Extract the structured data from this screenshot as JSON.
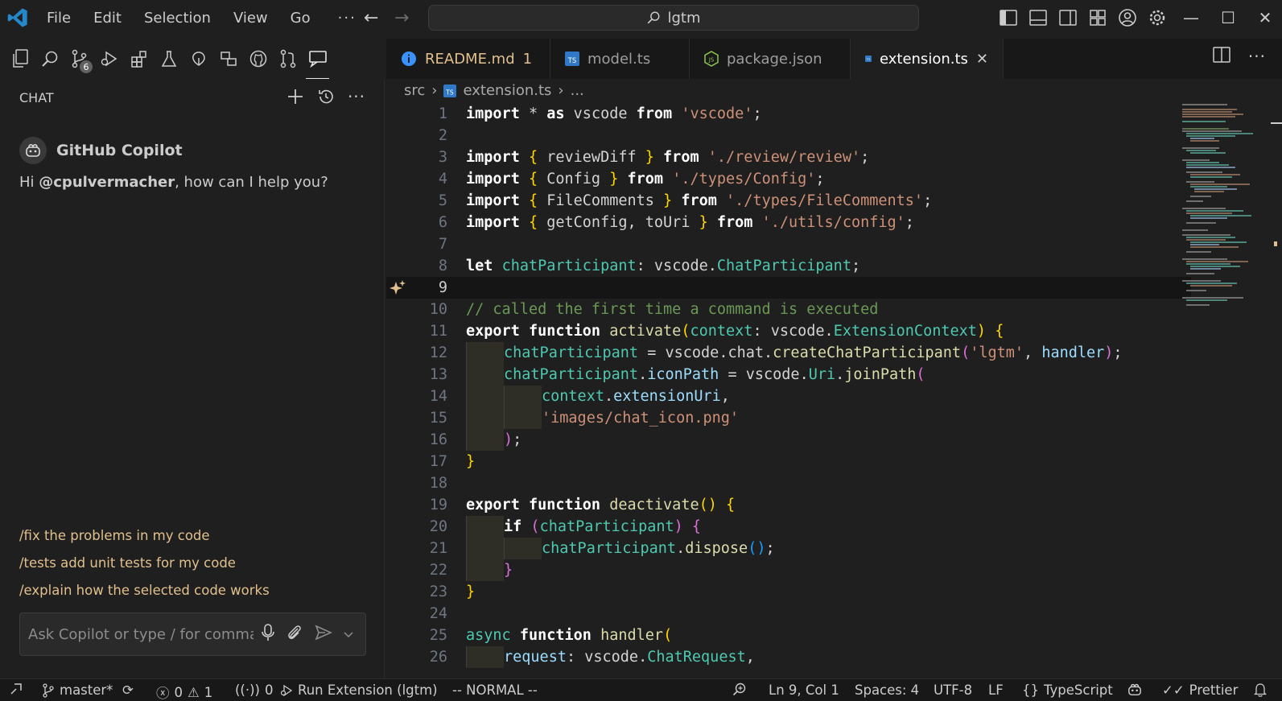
{
  "titlebar": {
    "menu": [
      "File",
      "Edit",
      "Selection",
      "View",
      "Go"
    ],
    "more": "···",
    "search_text": "lgtm"
  },
  "activity": {
    "items": [
      "explorer-icon",
      "search-icon",
      "source-control-icon",
      "run-debug-icon",
      "extensions-icon",
      "testing-icon",
      "live-share-icon",
      "remote-explorer-icon",
      "github-icon",
      "pull-requests-icon",
      "chat-icon"
    ],
    "source_control_badge": "6"
  },
  "chat": {
    "header": "CHAT",
    "bot_name": "GitHub Copilot",
    "greeting_prefix": "Hi ",
    "greeting_user": "@cpulvermacher",
    "greeting_suffix": ", how can I help you?",
    "suggestions": [
      "/fix the problems in my code",
      "/tests add unit tests for my code",
      "/explain how the selected code works"
    ],
    "input_placeholder": "Ask Copilot or type / for commands"
  },
  "tabs": [
    {
      "label": "README.md",
      "badge": "1",
      "icon": "info-icon"
    },
    {
      "label": "model.ts",
      "icon": "ts-icon"
    },
    {
      "label": "package.json",
      "icon": "nodejs-icon"
    },
    {
      "label": "extension.ts",
      "icon": "ts-icon",
      "active": true
    }
  ],
  "breadcrumb": {
    "folder": "src",
    "file": "extension.ts",
    "more": "..."
  },
  "code_line_numbers": [
    "1",
    "2",
    "3",
    "4",
    "5",
    "6",
    "7",
    "8",
    "9",
    "10",
    "11",
    "12",
    "13",
    "14",
    "15",
    "16",
    "17",
    "18",
    "19",
    "20",
    "21",
    "22",
    "23",
    "24",
    "25",
    "26"
  ],
  "status": {
    "branch": "master*",
    "errors": "0",
    "warnings": "1",
    "ports": "0",
    "run": "Run Extension (lgtm)",
    "mode": "-- NORMAL --",
    "position": "Ln 9, Col 1",
    "spaces": "Spaces: 4",
    "encoding": "UTF-8",
    "eol": "LF",
    "language": "TypeScript",
    "formatter": "Prettier"
  },
  "colors": {
    "accent": "#0078d4",
    "suggestion": "#e2c08d",
    "string": "#ce9178",
    "type": "#4ec9b0"
  }
}
